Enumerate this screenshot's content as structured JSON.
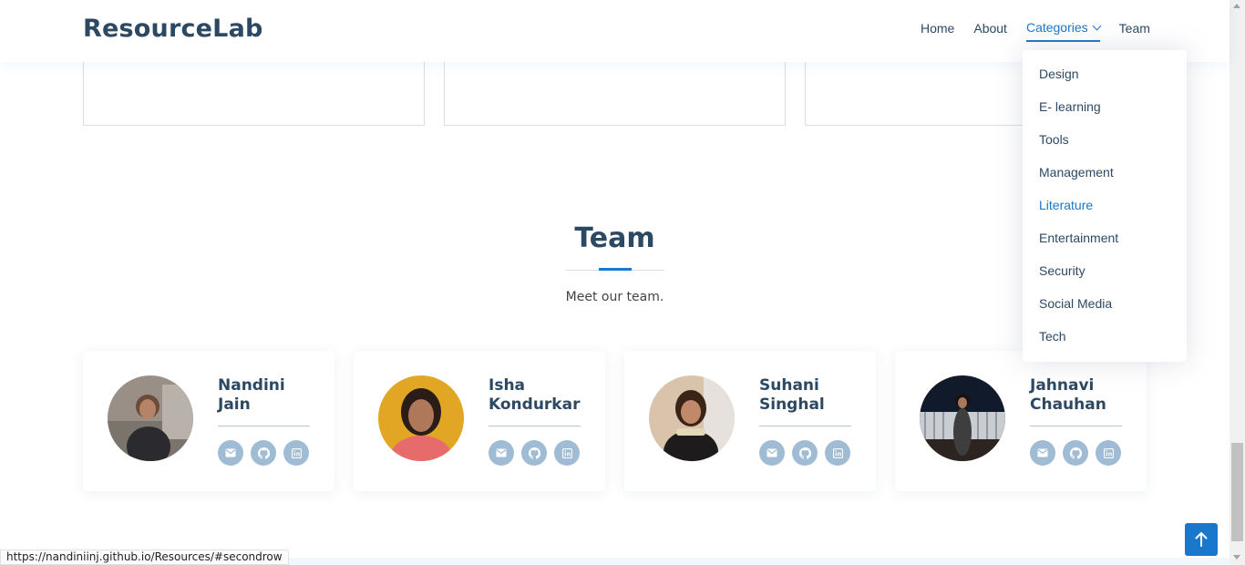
{
  "brand": {
    "logo": "ResourceLab"
  },
  "nav": {
    "items": [
      "Home",
      "About",
      "Categories",
      "Team"
    ]
  },
  "dropdown": {
    "items": [
      "Design",
      "E- learning",
      "Tools",
      "Management",
      "Literature",
      "Entertainment",
      "Security",
      "Social Media",
      "Tech"
    ],
    "active": "Literature"
  },
  "team_section": {
    "title": "Team",
    "subtitle": "Meet our team.",
    "members": [
      {
        "name": "Nandini Jain"
      },
      {
        "name": "Isha Kondurkar"
      },
      {
        "name": "Suhani Singhal"
      },
      {
        "name": "Jahnavi Chauhan"
      }
    ]
  },
  "status_bar": {
    "url": "https://nandiniinj.github.io/Resources/#secondrow"
  },
  "colors": {
    "brand": "#2c4964",
    "accent": "#1977cc",
    "social": "#a0bcd5"
  }
}
